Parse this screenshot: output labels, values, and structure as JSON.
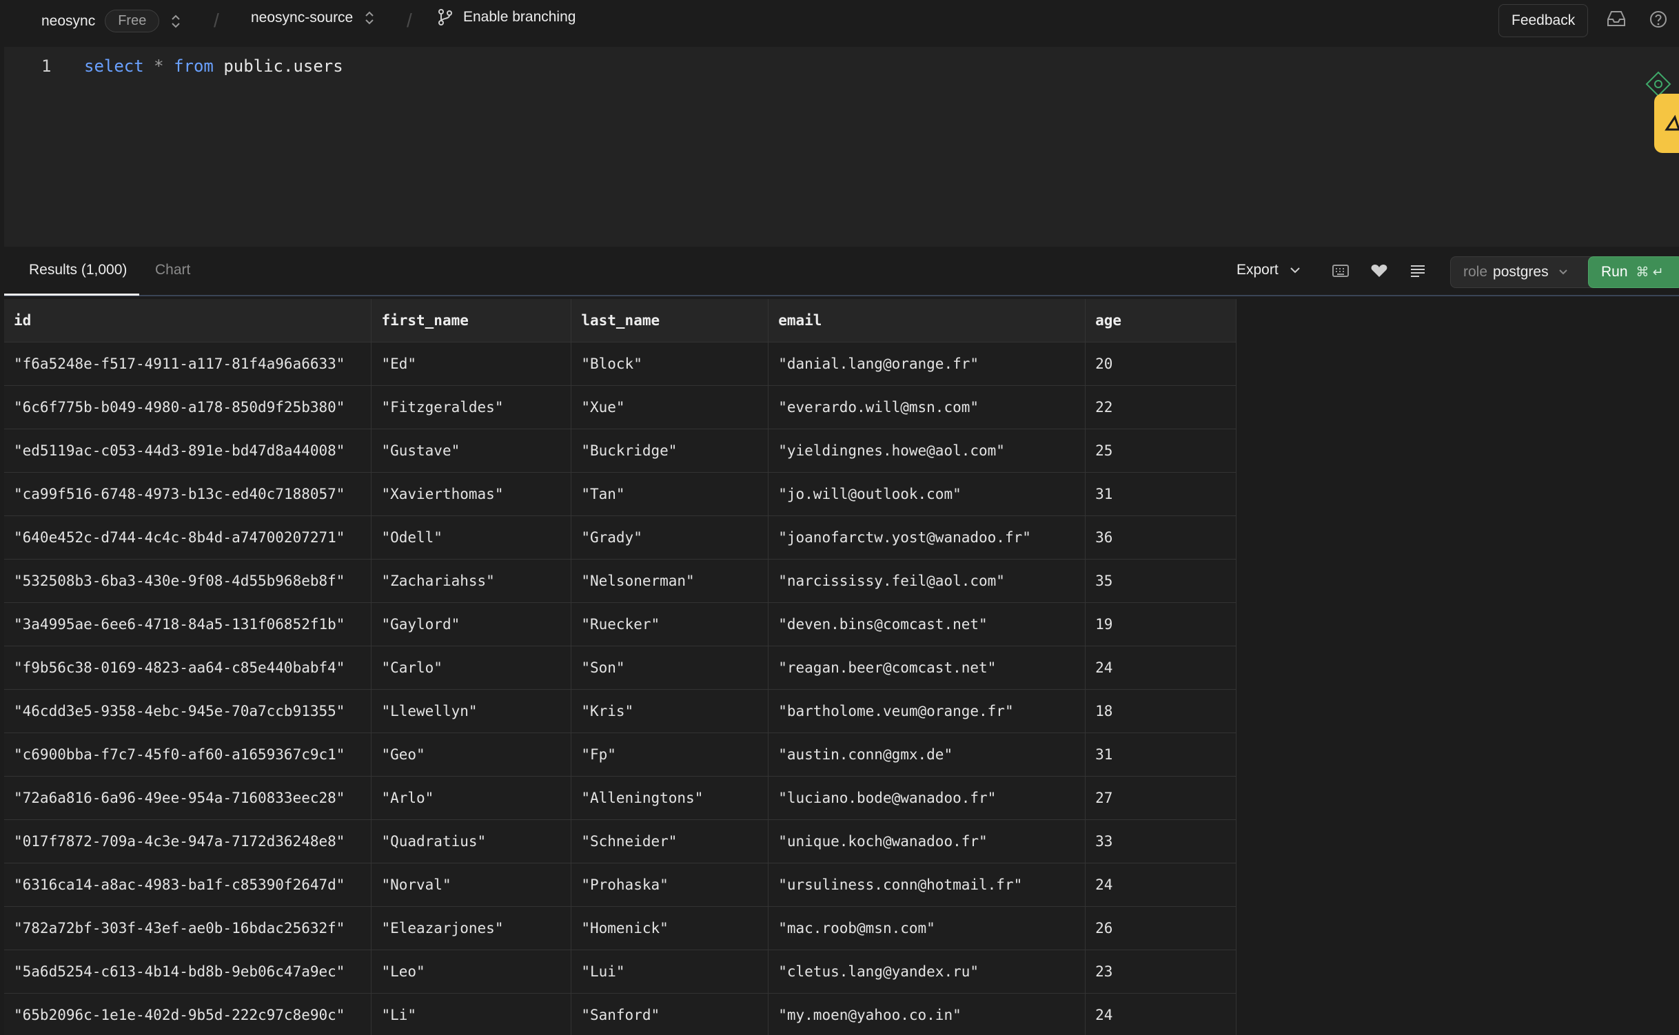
{
  "topbar": {
    "org_name": "neosync",
    "plan": "Free",
    "project": "neosync-source",
    "branching_label": "Enable branching",
    "feedback_label": "Feedback"
  },
  "editor": {
    "line_number": "1",
    "kw_select": "select",
    "star": "*",
    "kw_from": "from",
    "table_ref": "public.users"
  },
  "results": {
    "tab_results": "Results (1,000)",
    "tab_chart": "Chart",
    "export_label": "Export",
    "role_label": "role",
    "role_value": "postgres",
    "run_label": "Run",
    "run_shortcut": "⌘ ↵"
  },
  "table": {
    "columns": [
      "id",
      "first_name",
      "last_name",
      "email",
      "age"
    ],
    "rows": [
      [
        "\"f6a5248e-f517-4911-a117-81f4a96a6633\"",
        "\"Ed\"",
        "\"Block\"",
        "\"danial.lang@orange.fr\"",
        "20"
      ],
      [
        "\"6c6f775b-b049-4980-a178-850d9f25b380\"",
        "\"Fitzgeraldes\"",
        "\"Xue\"",
        "\"everardo.will@msn.com\"",
        "22"
      ],
      [
        "\"ed5119ac-c053-44d3-891e-bd47d8a44008\"",
        "\"Gustave\"",
        "\"Buckridge\"",
        "\"yieldingnes.howe@aol.com\"",
        "25"
      ],
      [
        "\"ca99f516-6748-4973-b13c-ed40c7188057\"",
        "\"Xavierthomas\"",
        "\"Tan\"",
        "\"jo.will@outlook.com\"",
        "31"
      ],
      [
        "\"640e452c-d744-4c4c-8b4d-a74700207271\"",
        "\"Odell\"",
        "\"Grady\"",
        "\"joanofarctw.yost@wanadoo.fr\"",
        "36"
      ],
      [
        "\"532508b3-6ba3-430e-9f08-4d55b968eb8f\"",
        "\"Zachariahss\"",
        "\"Nelsonerman\"",
        "\"narcississy.feil@aol.com\"",
        "35"
      ],
      [
        "\"3a4995ae-6ee6-4718-84a5-131f06852f1b\"",
        "\"Gaylord\"",
        "\"Ruecker\"",
        "\"deven.bins@comcast.net\"",
        "19"
      ],
      [
        "\"f9b56c38-0169-4823-aa64-c85e440babf4\"",
        "\"Carlo\"",
        "\"Son\"",
        "\"reagan.beer@comcast.net\"",
        "24"
      ],
      [
        "\"46cdd3e5-9358-4ebc-945e-70a7ccb91355\"",
        "\"Llewellyn\"",
        "\"Kris\"",
        "\"bartholome.veum@orange.fr\"",
        "18"
      ],
      [
        "\"c6900bba-f7c7-45f0-af60-a1659367c9c1\"",
        "\"Geo\"",
        "\"Fp\"",
        "\"austin.conn@gmx.de\"",
        "31"
      ],
      [
        "\"72a6a816-6a96-49ee-954a-7160833eec28\"",
        "\"Arlo\"",
        "\"Alleningtons\"",
        "\"luciano.bode@wanadoo.fr\"",
        "27"
      ],
      [
        "\"017f7872-709a-4c3e-947a-7172d36248e8\"",
        "\"Quadratius\"",
        "\"Schneider\"",
        "\"unique.koch@wanadoo.fr\"",
        "33"
      ],
      [
        "\"6316ca14-a8ac-4983-ba1f-c85390f2647d\"",
        "\"Norval\"",
        "\"Prohaska\"",
        "\"ursuliness.conn@hotmail.fr\"",
        "24"
      ],
      [
        "\"782a72bf-303f-43ef-ae0b-16bdac25632f\"",
        "\"Eleazarjones\"",
        "\"Homenick\"",
        "\"mac.roob@msn.com\"",
        "26"
      ],
      [
        "\"5a6d5254-c613-4b14-bd8b-9eb06c47a9ec\"",
        "\"Leo\"",
        "\"Lui\"",
        "\"cletus.lang@yandex.ru\"",
        "23"
      ],
      [
        "\"65b2096c-1e1e-402d-9b5d-222c97c8e90c\"",
        "\"Li\"",
        "\"Sanford\"",
        "\"my.moen@yahoo.co.in\"",
        "24"
      ]
    ]
  },
  "colors": {
    "background": "#1c1c1c",
    "run_green": "#3f8f56",
    "keyword_blue": "#6aa1ff",
    "side_tab_yellow": "#f5c542"
  },
  "icons": [
    "chevron-updown-icon",
    "git-branch-icon",
    "inbox-icon",
    "help-icon",
    "ai-diamond-icon",
    "chevron-down-icon",
    "keyboard-icon",
    "heart-icon",
    "text-align-icon",
    "enter-icon"
  ]
}
